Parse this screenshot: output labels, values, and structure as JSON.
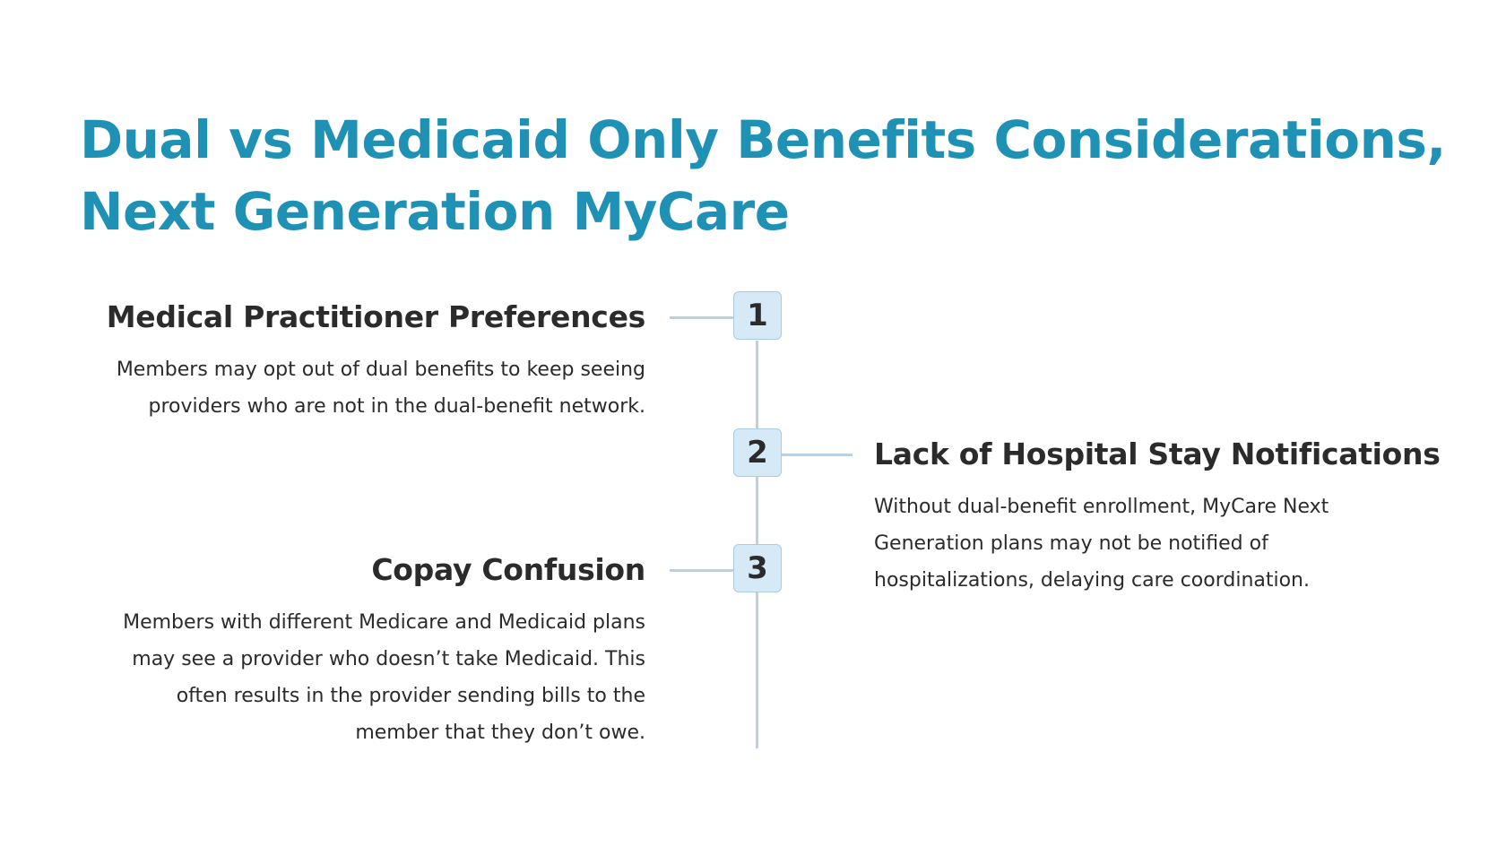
{
  "title": {
    "line1": "Dual vs Medicaid Only Benefits Considerations,",
    "line2": "Next Generation MyCare"
  },
  "steps": [
    {
      "number": "1",
      "heading": "Medical Practitioner Preferences",
      "body": [
        "Members may opt out of dual benefits to keep seeing",
        "providers who are not in the dual-benefit network."
      ]
    },
    {
      "number": "2",
      "heading": "Lack of Hospital Stay Notifications",
      "body": [
        "Without dual-benefit enrollment, MyCare Next",
        "Generation plans may not be notified of",
        "hospitalizations, delaying care coordination."
      ]
    },
    {
      "number": "3",
      "heading": "Copay Confusion",
      "body": [
        "Members with different Medicare and Medicaid plans",
        "may see a provider who doesn’t take Medicaid. This",
        "often results in the provider sending bills to the",
        "member that they don’t owe."
      ]
    }
  ],
  "colors": {
    "title": "#1f91b4",
    "text": "#2b2b2b",
    "line": "#b9d1e2",
    "box_fill": "#d6e9f6",
    "box_border": "#a9cbe3"
  }
}
